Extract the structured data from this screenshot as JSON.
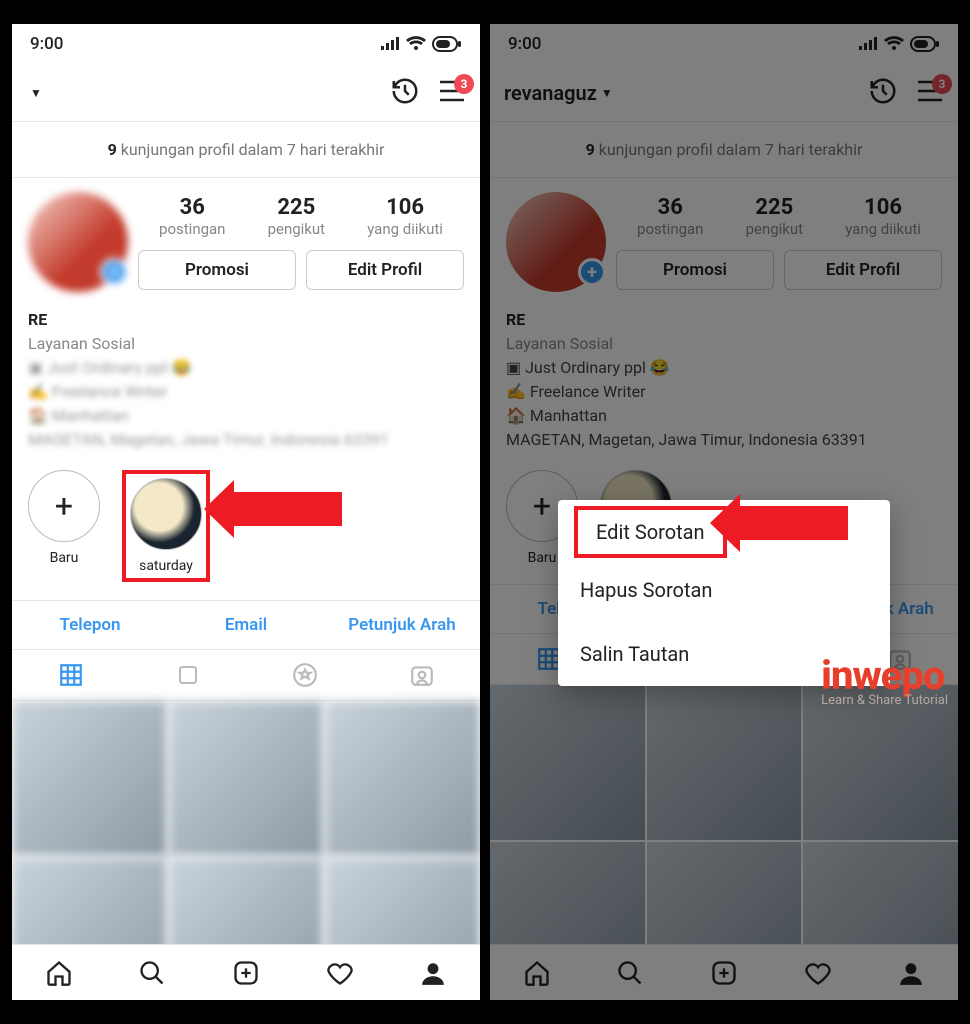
{
  "status": {
    "time": "9:00"
  },
  "header": {
    "username_left": "",
    "username_right": "revanaguz",
    "badge": "3"
  },
  "insights": {
    "count": "9",
    "text": " kunjungan profil dalam 7 hari terakhir"
  },
  "stats": {
    "posts": {
      "num": "36",
      "label": "postingan"
    },
    "followers": {
      "num": "225",
      "label": "pengikut"
    },
    "following": {
      "num": "106",
      "label": "yang diikuti"
    }
  },
  "buttons": {
    "promo": "Promosi",
    "edit": "Edit Profil"
  },
  "bio": {
    "name": "RE",
    "category": "Layanan Sosial",
    "line1": "▣  Just Ordinary ppl 😂",
    "line2": "✍️  Freelance Writer",
    "line3": "🏠  Manhattan",
    "line4_blur": "MAGETAN, Magetan, Jawa Timur, Indonesia 63391"
  },
  "highlights": {
    "new": "Baru",
    "hl1": "saturday"
  },
  "contacts": {
    "phone": "Telepon",
    "email": "Email",
    "dir": "Petunjuk Arah"
  },
  "popup": {
    "edit": "Edit Sorotan",
    "delete": "Hapus Sorotan",
    "copy": "Salin Tautan"
  },
  "watermark": {
    "brand": "inwepo",
    "tag": "Learn & Share Tutorial"
  }
}
